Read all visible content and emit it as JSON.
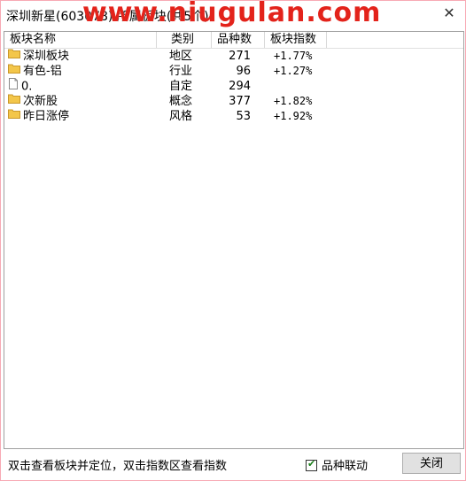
{
  "window": {
    "title": "深圳新星(603078)   所属板块(共5个)",
    "watermark": "www.niugulan.com",
    "close_glyph": "✕"
  },
  "list": {
    "headers": [
      "板块名称",
      "类别",
      "品种数",
      "板块指数"
    ],
    "rows": [
      {
        "name": "深圳板块",
        "category": "地区",
        "count": "271",
        "index": "+1.77%",
        "icon": "folder-icon"
      },
      {
        "name": "有色-铝",
        "category": "行业",
        "count": "96",
        "index": "+1.27%",
        "icon": "folder-icon"
      },
      {
        "name": "0.",
        "category": "自定",
        "count": "294",
        "index": "",
        "icon": "document-icon"
      },
      {
        "name": "次新股",
        "category": "概念",
        "count": "377",
        "index": "+1.82%",
        "icon": "folder-icon"
      },
      {
        "name": "昨日涨停",
        "category": "风格",
        "count": "53",
        "index": "+1.92%",
        "icon": "folder-icon"
      }
    ]
  },
  "footer": {
    "hint": "双击查看板块并定位，双击指数区查看指数",
    "checkbox_label": "品种联动",
    "checkbox_checked": true,
    "close_label": "关闭"
  },
  "colors": {
    "watermark": "#e3231b",
    "folder": "#f3c64a",
    "window_border": "#f7a9b4"
  }
}
